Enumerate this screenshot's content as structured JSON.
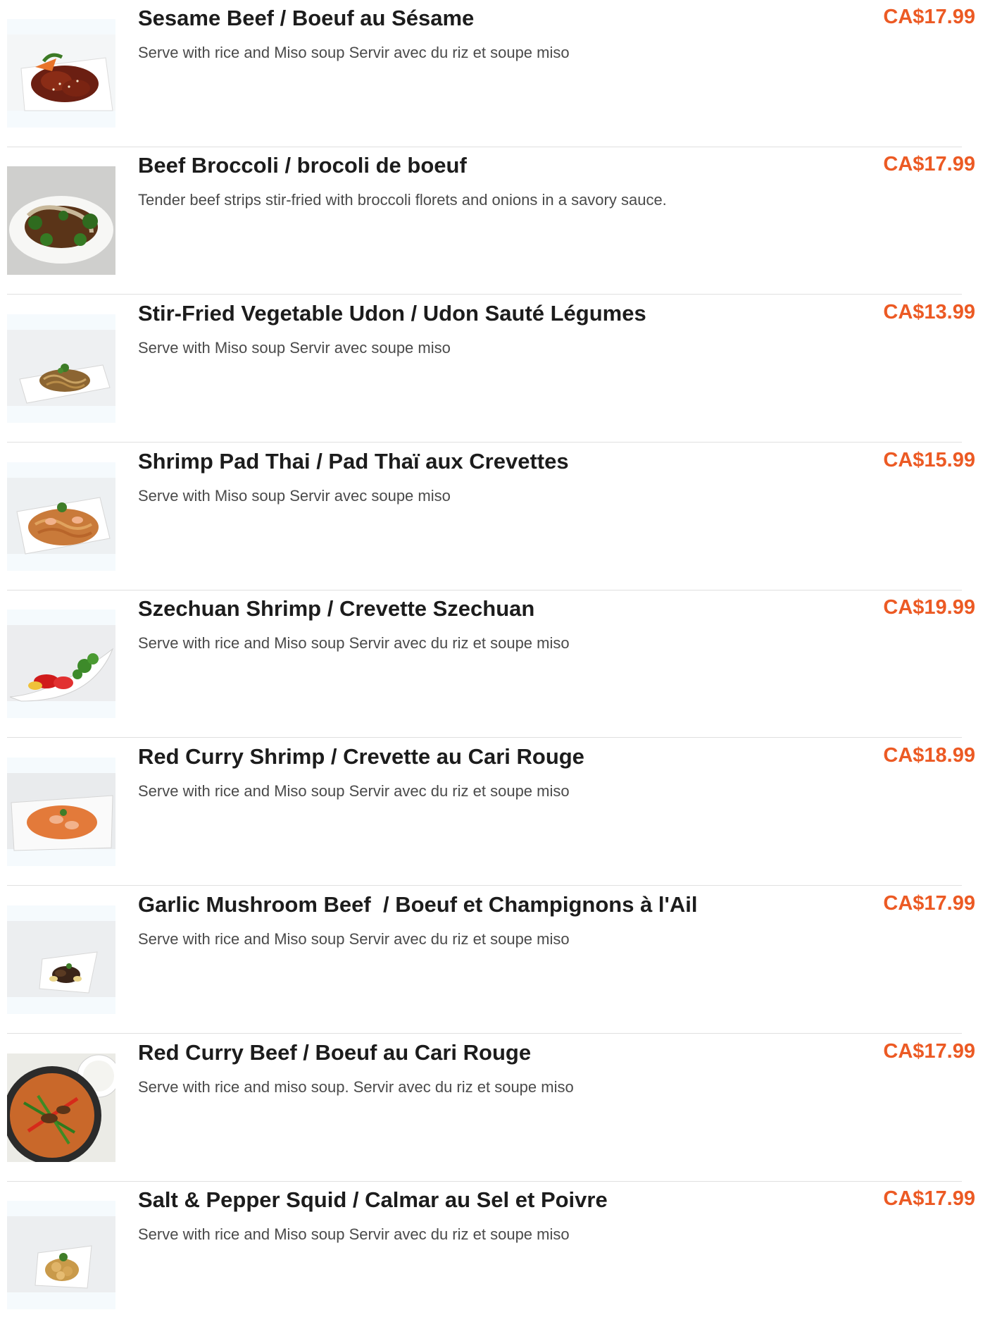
{
  "currency_color": "#ec5a24",
  "items": [
    {
      "name": "Sesame Beef / Boeuf au Sésame",
      "description": "Serve with rice and Miso soup Servir avec du riz et soupe miso",
      "price": "CA$17.99",
      "image": "sesame-beef-photo"
    },
    {
      "name": "Beef Broccoli / brocoli de boeuf",
      "description": "Tender beef strips stir-fried with broccoli florets and onions in a savory sauce.",
      "price": "CA$17.99",
      "image": "beef-broccoli-photo"
    },
    {
      "name": "Stir-Fried Vegetable Udon / Udon Sauté Légumes",
      "description": "Serve with Miso soup Servir avec soupe miso",
      "price": "CA$13.99",
      "image": "vegetable-udon-photo"
    },
    {
      "name": "Shrimp Pad Thai / Pad Thaï aux Crevettes",
      "description": "Serve with Miso soup Servir avec soupe miso",
      "price": "CA$15.99",
      "image": "shrimp-pad-thai-photo"
    },
    {
      "name": "Szechuan Shrimp / Crevette Szechuan",
      "description": "Serve with rice and Miso soup Servir avec du riz et soupe miso",
      "price": "CA$19.99",
      "image": "szechuan-shrimp-photo"
    },
    {
      "name": "Red Curry Shrimp / Crevette au Cari Rouge",
      "description": "Serve with rice and Miso soup Servir avec du riz et soupe miso",
      "price": "CA$18.99",
      "image": "red-curry-shrimp-photo"
    },
    {
      "name": "Garlic Mushroom Beef  / Boeuf et Champignons à l'Ail",
      "description": "Serve with rice and Miso soup Servir avec du riz et soupe miso",
      "price": "CA$17.99",
      "image": "garlic-mushroom-beef-photo"
    },
    {
      "name": "Red Curry Beef / Boeuf au Cari Rouge",
      "description": "Serve with rice and miso soup. Servir avec du riz et soupe miso",
      "price": "CA$17.99",
      "image": "red-curry-beef-photo"
    },
    {
      "name": "Salt & Pepper Squid / Calmar au Sel et Poivre",
      "description": "Serve with rice and Miso soup Servir avec du riz et soupe miso",
      "price": "CA$17.99",
      "image": "salt-pepper-squid-photo"
    }
  ]
}
